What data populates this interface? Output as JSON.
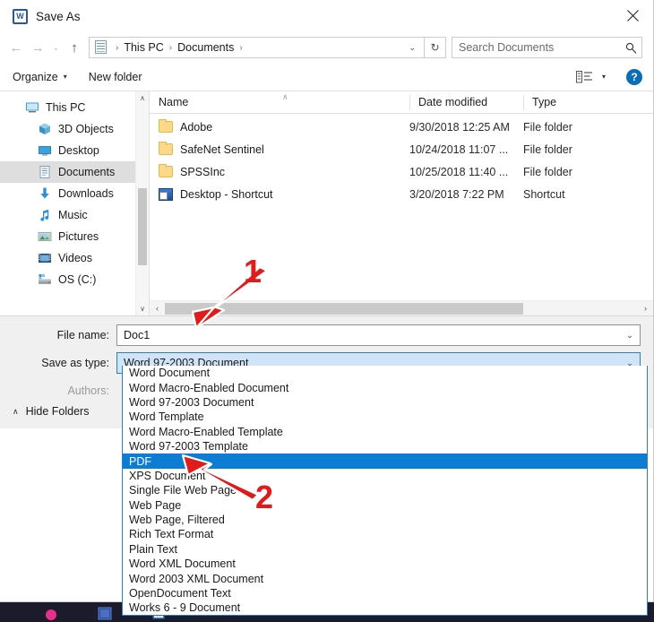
{
  "window": {
    "title": "Save As",
    "app_icon": "word-icon",
    "app_icon_letter": "W",
    "close_label": "✕"
  },
  "addressbar": {
    "back_label": "←",
    "forward_label": "→",
    "recent_label": "⌄",
    "up_label": "↑",
    "path_icon": "documents-folder-icon",
    "crumbs": [
      "This PC",
      "Documents"
    ],
    "separator": "›",
    "dropdown_caret": "⌄",
    "refresh_label": "↻"
  },
  "search": {
    "placeholder": "Search Documents",
    "value": "",
    "icon": "search-icon"
  },
  "commandbar": {
    "organize_label": "Organize",
    "organize_caret": "▾",
    "new_folder_label": "New folder",
    "view_icon": "list-view-icon",
    "view_caret": "▾",
    "help_label": "?"
  },
  "navpane": {
    "items": [
      {
        "label": "This PC",
        "icon": "monitor-icon",
        "indent": false,
        "selected": false
      },
      {
        "label": "3D Objects",
        "icon": "cube-icon",
        "indent": true,
        "selected": false
      },
      {
        "label": "Desktop",
        "icon": "desktop-icon",
        "indent": true,
        "selected": false
      },
      {
        "label": "Documents",
        "icon": "documents-icon",
        "indent": true,
        "selected": true
      },
      {
        "label": "Downloads",
        "icon": "download-arrow-icon",
        "indent": true,
        "selected": false
      },
      {
        "label": "Music",
        "icon": "music-note-icon",
        "indent": true,
        "selected": false
      },
      {
        "label": "Pictures",
        "icon": "pictures-icon",
        "indent": true,
        "selected": false
      },
      {
        "label": "Videos",
        "icon": "videos-icon",
        "indent": true,
        "selected": false
      },
      {
        "label": "OS (C:)",
        "icon": "drive-icon",
        "indent": true,
        "selected": false
      }
    ],
    "scroll_up": "∧",
    "scroll_down": "∨"
  },
  "filelist": {
    "columns": [
      "Name",
      "Date modified",
      "Type"
    ],
    "sort_indicator": "∧",
    "rows": [
      {
        "name": "Adobe",
        "date": "9/30/2018 12:25 AM",
        "type": "File folder",
        "icon": "folder-icon"
      },
      {
        "name": "SafeNet Sentinel",
        "date": "10/24/2018 11:07 ...",
        "type": "File folder",
        "icon": "folder-icon"
      },
      {
        "name": "SPSSInc",
        "date": "10/25/2018 11:40 ...",
        "type": "File folder",
        "icon": "folder-icon"
      },
      {
        "name": "Desktop - Shortcut",
        "date": "3/20/2018 7:22 PM",
        "type": "Shortcut",
        "icon": "shortcut-icon"
      }
    ],
    "hscroll_left": "‹",
    "hscroll_right": "›"
  },
  "form": {
    "file_name_label": "File name:",
    "file_name_value": "Doc1",
    "save_as_type_label": "Save as type:",
    "save_as_type_value": "Word 97-2003 Document",
    "authors_label": "Authors:",
    "authors_value": "",
    "combo_caret": "⌄",
    "hide_folders_label": "Hide Folders",
    "hide_folders_caret": "∧"
  },
  "dropdown": {
    "selected": "PDF",
    "options": [
      "Word Document",
      "Word Macro-Enabled Document",
      "Word 97-2003 Document",
      "Word Template",
      "Word Macro-Enabled Template",
      "Word 97-2003 Template",
      "PDF",
      "XPS Document",
      "Single File Web Page",
      "Web Page",
      "Web Page, Filtered",
      "Rich Text Format",
      "Plain Text",
      "Word XML Document",
      "Word 2003 XML Document",
      "OpenDocument Text",
      "Works 6 - 9 Document"
    ]
  },
  "annotations": [
    {
      "number": "1",
      "target": "file-name-field"
    },
    {
      "number": "2",
      "target": "pdf-option"
    }
  ],
  "colors": {
    "accent_selection": "#0c7cd5",
    "combo_highlight": "#cfe4f7",
    "combo_border": "#2f7cc4",
    "annotation_red": "#e01b1b",
    "nav_selected": "#dedede",
    "form_background": "#f0f0f0",
    "help_blue": "#0b6cba",
    "folder_yellow": "#fcd988"
  }
}
